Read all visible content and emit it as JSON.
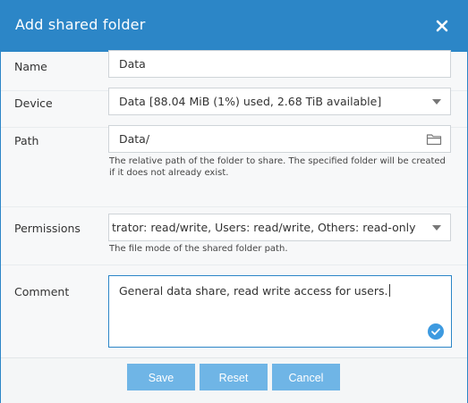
{
  "dialog": {
    "title": "Add shared folder"
  },
  "fields": {
    "name": {
      "label": "Name",
      "value": "Data"
    },
    "device": {
      "label": "Device",
      "value": "Data [88.04 MiB (1%) used, 2.68 TiB available]"
    },
    "path": {
      "label": "Path",
      "value": "Data/",
      "hint_line1": "The relative path of the folder to share. The specified folder will be created",
      "hint_line2": "if it does not already exist."
    },
    "permissions": {
      "label": "Permissions",
      "value": "trator: read/write, Users: read/write, Others: read-only",
      "hint": "The file mode of the shared folder path."
    },
    "comment": {
      "label": "Comment",
      "value": "General data share, read write access for users."
    }
  },
  "footer": {
    "save_label": "Save",
    "reset_label": "Reset",
    "cancel_label": "Cancel"
  },
  "icons": {
    "close": "close-icon",
    "folder": "folder-icon",
    "dropdown": "chevron-down-icon",
    "valid": "checkmark-circle-icon"
  },
  "colors": {
    "accent": "#2c86c7",
    "button": "#6fb5e6",
    "valid_check": "#3d9ae0"
  }
}
